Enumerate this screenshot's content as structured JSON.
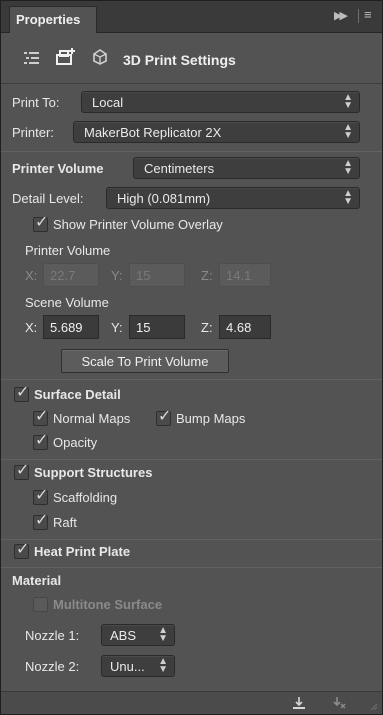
{
  "tab": {
    "label": "Properties"
  },
  "header": {
    "title": "3D Print Settings"
  },
  "print_to": {
    "label": "Print To:",
    "value": "Local"
  },
  "printer": {
    "label": "Printer:",
    "value": "MakerBot Replicator 2X"
  },
  "printer_volume_units": {
    "label": "Printer Volume",
    "value": "Centimeters"
  },
  "detail_level": {
    "label": "Detail Level:",
    "value": "High  (0.081mm)"
  },
  "show_overlay": {
    "label": "Show Printer Volume Overlay",
    "checked": true
  },
  "printer_volume": {
    "label": "Printer Volume",
    "x_label": "X:",
    "x": "22.7",
    "y_label": "Y:",
    "y": "15",
    "z_label": "Z:",
    "z": "14.1"
  },
  "scene_volume": {
    "label": "Scene Volume",
    "x_label": "X:",
    "x": "5.689",
    "y_label": "Y:",
    "y": "15",
    "z_label": "Z:",
    "z": "4.68"
  },
  "scale_button": {
    "label": "Scale To Print Volume"
  },
  "surface_detail": {
    "label": "Surface Detail",
    "checked": true,
    "normal_maps": "Normal Maps",
    "bump_maps": "Bump Maps",
    "opacity": "Opacity"
  },
  "support_structures": {
    "label": "Support Structures",
    "checked": true,
    "scaffolding": "Scaffolding",
    "raft": "Raft"
  },
  "heat_print_plate": {
    "label": "Heat Print Plate",
    "checked": true
  },
  "material": {
    "label": "Material",
    "multitone": {
      "label": "Multitone Surface",
      "checked": false
    },
    "nozzle1": {
      "label": "Nozzle 1:",
      "value": "ABS"
    },
    "nozzle2": {
      "label": "Nozzle 2:",
      "value": "Unu..."
    }
  }
}
